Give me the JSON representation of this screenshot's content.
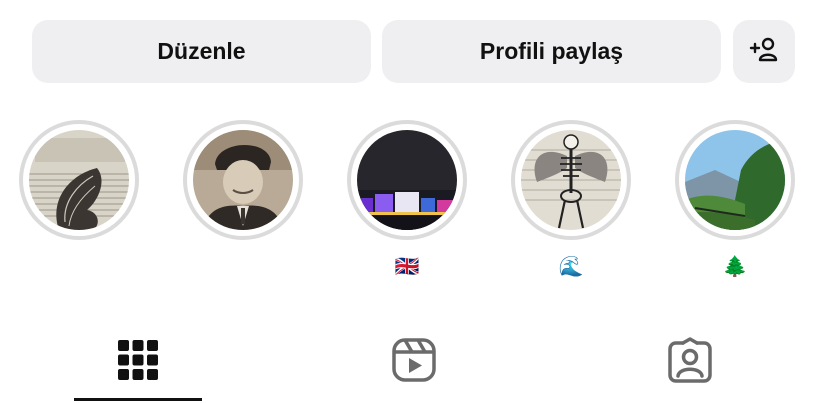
{
  "profile_actions": {
    "edit_label": "Düzenle",
    "share_label": "Profili paylaş",
    "add_person_icon": "add-person-icon"
  },
  "highlights": [
    {
      "label": "",
      "cover": "butterfly-newspaper-art"
    },
    {
      "label": "",
      "cover": "portrait-with-fur-hat"
    },
    {
      "label": "🇬🇧",
      "cover": "night-castle-lights"
    },
    {
      "label": "🌊",
      "cover": "skeleton-with-wings-art"
    },
    {
      "label": "🌲",
      "cover": "green-mountain-valley"
    }
  ],
  "tabs": [
    {
      "icon": "grid-icon",
      "active": true
    },
    {
      "icon": "reels-icon",
      "active": false
    },
    {
      "icon": "tagged-icon",
      "active": false
    }
  ],
  "colors": {
    "button_bg": "#efeff1",
    "ring": "#dbdbdb",
    "icon_active": "#111111",
    "icon_inactive": "#6b6b6b"
  }
}
